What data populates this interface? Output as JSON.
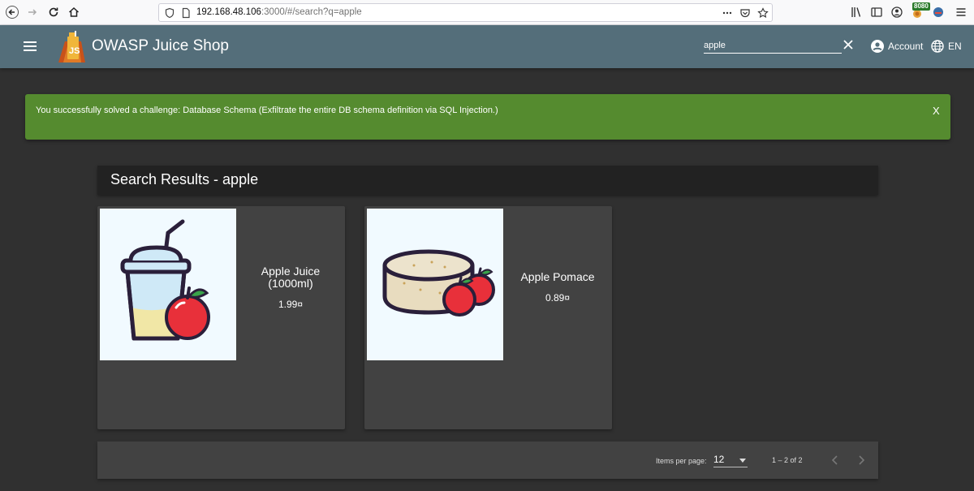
{
  "browser": {
    "url_host": "192.168.48.106",
    "url_rest": ":3000/#/search?q=apple",
    "badge": "8080"
  },
  "toolbar": {
    "title": "OWASP Juice Shop",
    "search_value": "apple",
    "account_label": "Account",
    "language": "EN"
  },
  "banner": {
    "message": "You successfully solved a challenge: Database Schema (Exfiltrate the entire DB schema definition via SQL Injection.)",
    "close_label": "X",
    "color": "#558b2f"
  },
  "results": {
    "title": "Search Results - apple",
    "products": [
      {
        "name": "Apple Juice (1000ml)",
        "price": "1.99¤"
      },
      {
        "name": "Apple Pomace",
        "price": "0.89¤"
      }
    ]
  },
  "paginator": {
    "items_per_page_label": "Items per page:",
    "items_per_page": "12",
    "range": "1 – 2 of 2"
  },
  "colors": {
    "toolbar": "#546e7a",
    "background": "#303030",
    "card": "#424242"
  }
}
